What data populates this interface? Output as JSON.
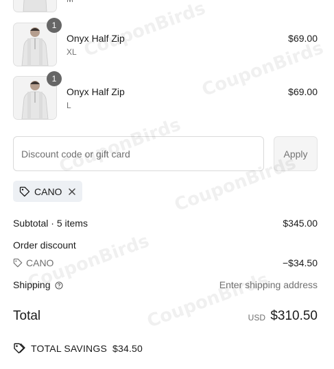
{
  "line_items": [
    {
      "name": "",
      "variant": "M",
      "price": "",
      "qty": ""
    },
    {
      "name": "Onyx Half Zip",
      "variant": "XL",
      "price": "$69.00",
      "qty": "1"
    },
    {
      "name": "Onyx Half Zip",
      "variant": "L",
      "price": "$69.00",
      "qty": "1"
    }
  ],
  "discount": {
    "placeholder": "Discount code or gift card",
    "apply_label": "Apply",
    "applied_code": "CANO"
  },
  "summary": {
    "subtotal_label": "Subtotal · 5 items",
    "subtotal_value": "$345.00",
    "order_discount_label": "Order discount",
    "discount_code": "CANO",
    "discount_value": "−$34.50",
    "shipping_label": "Shipping",
    "shipping_value": "Enter shipping address",
    "total_label": "Total",
    "currency": "USD",
    "total_value": "$310.50",
    "savings_label": "TOTAL SAVINGS",
    "savings_value": "$34.50"
  },
  "watermark_text": "CouponBirds",
  "icons": [
    "tag-icon",
    "close-icon",
    "help-circle-icon",
    "double-tag-icon"
  ],
  "colors": {
    "badge": "#666666",
    "chip_bg": "#edf0f4",
    "muted": "#707070"
  }
}
